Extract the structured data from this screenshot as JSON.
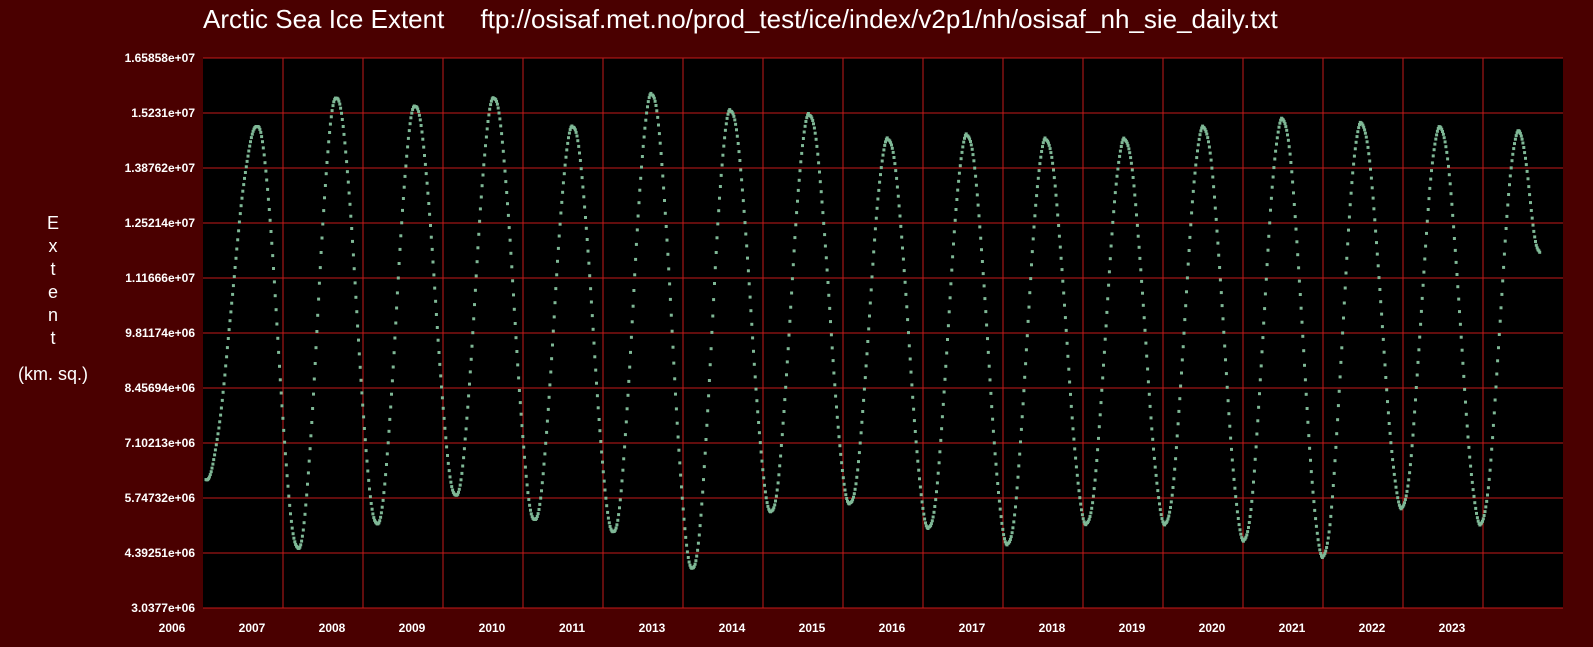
{
  "chart_data": {
    "type": "scatter",
    "title": "Arctic Sea Ice Extent",
    "source": "ftp://osisaf.met.no/prod_test/ice/index/v2p1/nh/osisaf_nh_sie_daily.txt",
    "ylabel_letters": [
      "E",
      "x",
      "t",
      "e",
      "n",
      "t"
    ],
    "ylabel_unit": "(km. sq.)",
    "xlabel": "",
    "x_tick_labels": [
      "2006",
      "2007",
      "2008",
      "2009",
      "2010",
      "2011",
      "2013",
      "2014",
      "2015",
      "2016",
      "2017",
      "2018",
      "2019",
      "2020",
      "2021",
      "2022",
      "2023"
    ],
    "x_gridlines": [
      "2007",
      "2008",
      "2009",
      "2010",
      "2011",
      "2013",
      "2014",
      "2015",
      "2016",
      "2017",
      "2018",
      "2019",
      "2020",
      "2021",
      "2022",
      "2023"
    ],
    "y_tick_labels": [
      "1.65858e+07",
      "1.5231e+07",
      "1.38762e+07",
      "1.25214e+07",
      "1.11666e+07",
      "9.81174e+06",
      "8.45694e+06",
      "7.10213e+06",
      "5.74732e+06",
      "4.39251e+06",
      "3.0377e+06"
    ],
    "ylim": [
      3037700,
      16585800
    ],
    "grid": true,
    "series": [
      {
        "color": "#7fb896",
        "points": [
          {
            "x": "2006-07-15",
            "y": 6200000
          },
          {
            "x": "2007-03-10",
            "y": 14900000
          },
          {
            "x": "2007-09-15",
            "y": 4500000
          },
          {
            "x": "2008-03-10",
            "y": 15600000
          },
          {
            "x": "2008-09-15",
            "y": 5100000
          },
          {
            "x": "2009-03-10",
            "y": 15400000
          },
          {
            "x": "2009-09-15",
            "y": 5800000
          },
          {
            "x": "2010-03-10",
            "y": 15600000
          },
          {
            "x": "2010-09-15",
            "y": 5200000
          },
          {
            "x": "2011-03-10",
            "y": 14900000
          },
          {
            "x": "2011-09-15",
            "y": 4900000
          },
          {
            "x": "2012-03-10",
            "y": 15700000
          },
          {
            "x": "2012-09-15",
            "y": 4000000
          },
          {
            "x": "2013-03-10",
            "y": 15300000
          },
          {
            "x": "2013-09-15",
            "y": 5400000
          },
          {
            "x": "2014-03-10",
            "y": 15200000
          },
          {
            "x": "2014-09-15",
            "y": 5600000
          },
          {
            "x": "2015-03-10",
            "y": 14600000
          },
          {
            "x": "2015-09-15",
            "y": 5000000
          },
          {
            "x": "2016-03-10",
            "y": 14700000
          },
          {
            "x": "2016-09-15",
            "y": 4600000
          },
          {
            "x": "2017-03-10",
            "y": 14600000
          },
          {
            "x": "2017-09-15",
            "y": 5100000
          },
          {
            "x": "2018-03-10",
            "y": 14600000
          },
          {
            "x": "2018-09-15",
            "y": 5100000
          },
          {
            "x": "2019-03-10",
            "y": 14900000
          },
          {
            "x": "2019-09-15",
            "y": 4700000
          },
          {
            "x": "2020-03-10",
            "y": 15100000
          },
          {
            "x": "2020-09-15",
            "y": 4300000
          },
          {
            "x": "2021-03-10",
            "y": 15000000
          },
          {
            "x": "2021-09-15",
            "y": 5500000
          },
          {
            "x": "2022-03-10",
            "y": 14900000
          },
          {
            "x": "2022-09-15",
            "y": 5100000
          },
          {
            "x": "2023-03-10",
            "y": 14800000
          },
          {
            "x": "2023-06-15",
            "y": 11800000
          }
        ]
      }
    ]
  }
}
